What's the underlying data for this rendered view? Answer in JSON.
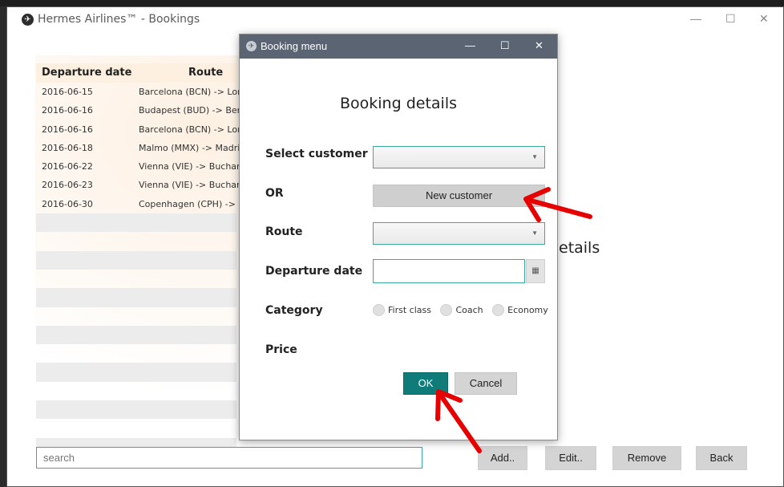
{
  "main_window": {
    "title": "Hermes Airlines™  -  Bookings",
    "controls": {
      "minimize": "—",
      "maximize": "☐",
      "close": "✕"
    }
  },
  "table": {
    "headers": [
      "Departure date",
      "Route"
    ],
    "rows": [
      [
        "2016-06-15",
        "Barcelona (BCN) -> Lon"
      ],
      [
        "2016-06-16",
        "Budapest (BUD) -> Berli"
      ],
      [
        "2016-06-16",
        "Barcelona (BCN) -> Lon"
      ],
      [
        "2016-06-18",
        "Malmo (MMX) -> Madri"
      ],
      [
        "2016-06-22",
        "Vienna (VIE) -> Buchare"
      ],
      [
        "2016-06-23",
        "Vienna (VIE) -> Buchare"
      ],
      [
        "2016-06-30",
        "Copenhagen (CPH) -> M"
      ]
    ]
  },
  "background_details_text": "etails",
  "search": {
    "placeholder": "search"
  },
  "buttons": {
    "add": "Add..",
    "edit": "Edit..",
    "remove": "Remove",
    "back": "Back"
  },
  "dialog": {
    "title": "Booking menu",
    "heading": "Booking details",
    "labels": {
      "select_customer": "Select customer",
      "or": "OR",
      "route": "Route",
      "departure_date": "Departure date",
      "category": "Category",
      "price": "Price"
    },
    "new_customer_button": "New customer",
    "categories": [
      "First class",
      "Coach",
      "Economy"
    ],
    "ok_button": "OK",
    "cancel_button": "Cancel",
    "controls": {
      "minimize": "—",
      "maximize": "☐",
      "close": "✕"
    }
  },
  "colors": {
    "accent": "#3aa99f",
    "ok_button": "#0f7c7a",
    "dialog_titlebar": "#5a6473",
    "annotation_arrow": "#e60000"
  }
}
